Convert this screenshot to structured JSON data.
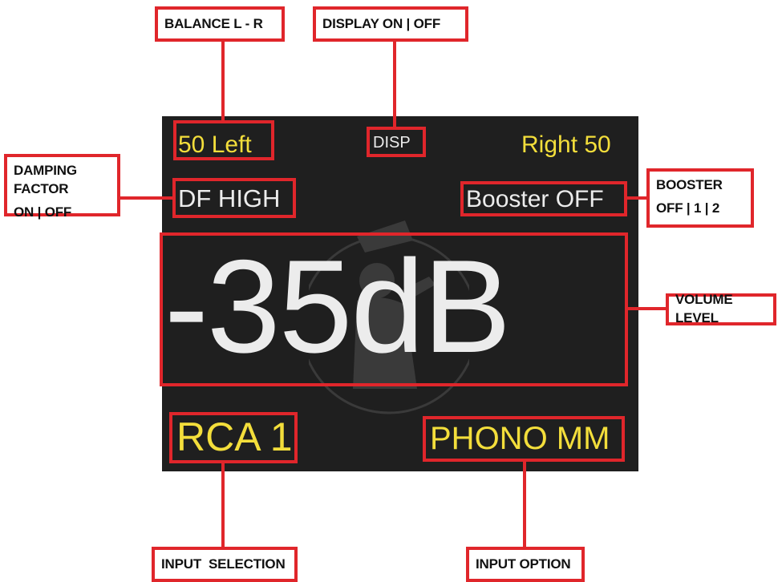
{
  "display": {
    "balance_left": "50 Left",
    "disp": "DISP",
    "balance_right": "Right 50",
    "damping": "DF HIGH",
    "booster": "Booster OFF",
    "volume": "-35dB",
    "input": "RCA 1",
    "input_option": "PHONO MM"
  },
  "callouts": {
    "balance": "BALANCE L - R",
    "display_toggle": "DISPLAY ON | OFF",
    "damping_line1": "DAMPING FACTOR",
    "damping_line2": "ON | OFF",
    "booster_line1": "BOOSTER",
    "booster_line2": "OFF | 1 | 2",
    "volume_level": "VOLUME LEVEL",
    "input_selection": "INPUT  SELECTION",
    "input_option": "INPUT OPTION"
  },
  "colors": {
    "screen_bg": "#1f1f1f",
    "highlight": "#e0262b",
    "yellow_text": "#f3de3b",
    "white_text": "#ececec"
  }
}
